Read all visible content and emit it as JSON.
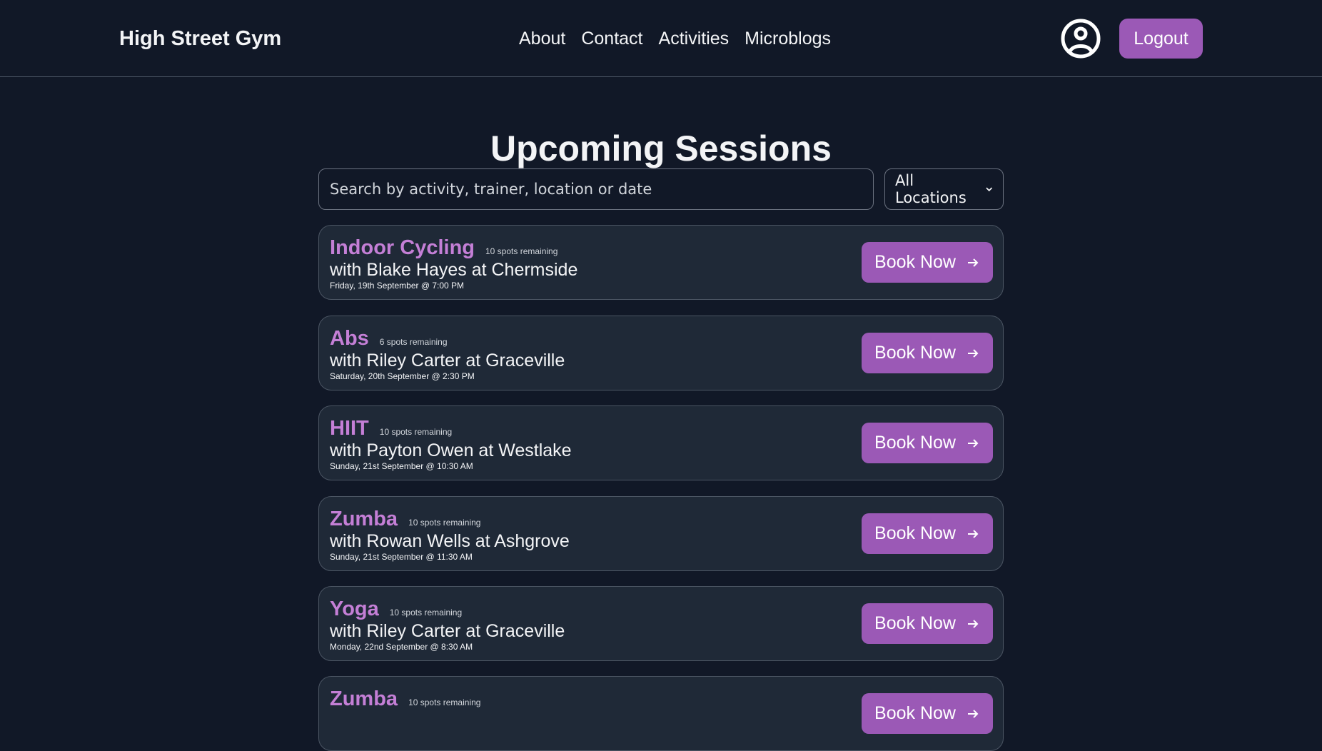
{
  "header": {
    "brand": "High Street Gym",
    "nav": [
      "About",
      "Contact",
      "Activities",
      "Microblogs"
    ],
    "logout_label": "Logout"
  },
  "main": {
    "title": "Upcoming Sessions",
    "search_placeholder": "Search by activity, trainer, location or date",
    "location_selected": "All Locations"
  },
  "sessions": [
    {
      "activity": "Indoor Cycling",
      "spots": "10 spots remaining",
      "trainer_line": "with Blake Hayes at Chermside",
      "date": "Friday, 19th September @ 7:00 PM",
      "button": "Book Now"
    },
    {
      "activity": "Abs",
      "spots": "6 spots remaining",
      "trainer_line": "with Riley Carter at Graceville",
      "date": "Saturday, 20th September @ 2:30 PM",
      "button": "Book Now"
    },
    {
      "activity": "HIIT",
      "spots": "10 spots remaining",
      "trainer_line": "with Payton Owen at Westlake",
      "date": "Sunday, 21st September @ 10:30 AM",
      "button": "Book Now"
    },
    {
      "activity": "Zumba",
      "spots": "10 spots remaining",
      "trainer_line": "with Rowan Wells at Ashgrove",
      "date": "Sunday, 21st September @ 11:30 AM",
      "button": "Book Now"
    },
    {
      "activity": "Yoga",
      "spots": "10 spots remaining",
      "trainer_line": "with Riley Carter at Graceville",
      "date": "Monday, 22nd September @ 8:30 AM",
      "button": "Book Now"
    },
    {
      "activity": "Zumba",
      "spots": "10 spots remaining",
      "trainer_line": "",
      "date": "",
      "button": "Book Now"
    }
  ],
  "colors": {
    "background": "#111827",
    "card": "#1f2937",
    "accent": "#9b59b6",
    "activity_text": "#c47fd6"
  },
  "icons": {
    "profile": "user-circle-icon",
    "book": "arrow-right-icon",
    "select": "chevron-down-icon"
  }
}
